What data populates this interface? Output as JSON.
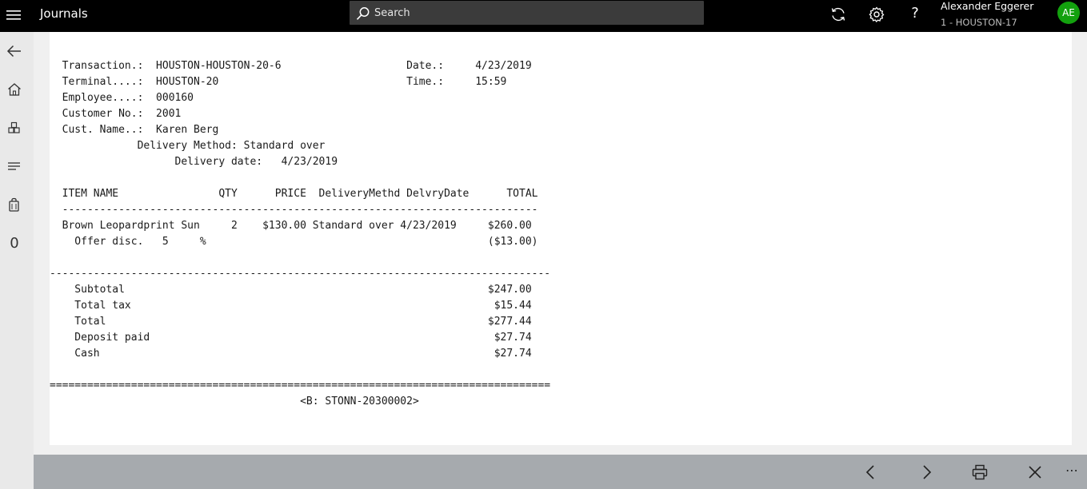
{
  "header": {
    "menu_icon": "hamburger-icon",
    "title": "Journals",
    "search_placeholder": "Search",
    "icons": [
      "refresh-icon",
      "gear-icon",
      "help-icon"
    ],
    "help_glyph": "?",
    "user_name": "Alexander Eggerer",
    "user_store": "1 - HOUSTON-17",
    "avatar_initials": "AE",
    "avatar_color": "#13a10e"
  },
  "rail": {
    "icons": [
      "back-arrow-icon",
      "home-icon",
      "products-icon",
      "list-icon",
      "bag-icon",
      "zero-icon"
    ],
    "zero_glyph": "0"
  },
  "receipt": {
    "lines": [
      "  Transaction.:  HOUSTON-HOUSTON-20-6                    Date.:     4/23/2019",
      "  Terminal....:  HOUSTON-20                              Time.:     15:59",
      "  Employee....:  000160",
      "  Customer No.:  2001",
      "  Cust. Name..:  Karen Berg",
      "              Delivery Method: Standard over",
      "                    Delivery date:   4/23/2019",
      "",
      "  ITEM NAME                QTY      PRICE  DeliveryMethd DelvryDate      TOTAL",
      "  ----------------------------------------------------------------------------",
      "  Brown Leopardprint Sun     2    $130.00 Standard over 4/23/2019     $260.00",
      "    Offer disc.   5     %                                             ($13.00)",
      "",
      "--------------------------------------------------------------------------------",
      "    Subtotal                                                          $247.00",
      "    Total tax                                                          $15.44",
      "    Total                                                             $277.44",
      "    Deposit paid                                                       $27.74",
      "    Cash                                                               $27.74",
      "",
      "================================================================================",
      "                                        <B: STONN-20300002>"
    ]
  },
  "footer": {
    "icons": [
      "previous-icon",
      "next-icon",
      "print-icon",
      "close-icon",
      "more-icon"
    ],
    "more_label": "⋯"
  }
}
